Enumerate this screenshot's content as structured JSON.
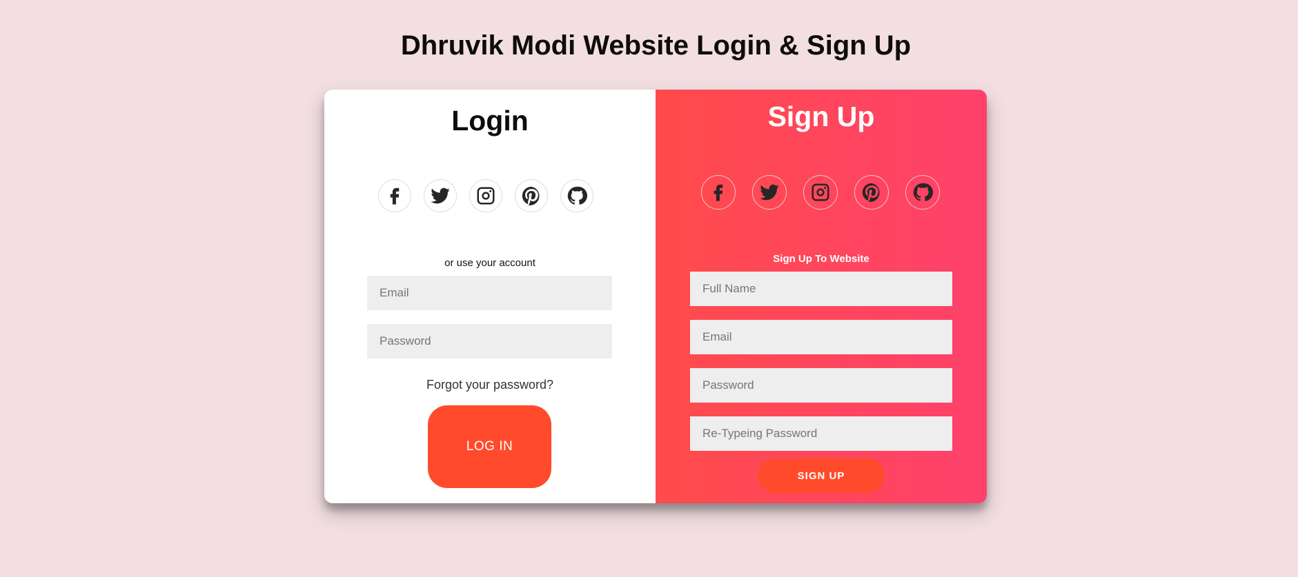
{
  "page": {
    "title": "Dhruvik Modi Website Login & Sign Up"
  },
  "login": {
    "title": "Login",
    "social_icons": [
      "facebook-icon",
      "twitter-icon",
      "instagram-icon",
      "pinterest-icon",
      "github-icon"
    ],
    "hint": "or use your account",
    "email_placeholder": "Email",
    "password_placeholder": "Password",
    "forgot_text": "Forgot your password?",
    "button_label": "LOG IN"
  },
  "signup": {
    "title": "Sign Up",
    "social_icons": [
      "facebook-icon",
      "twitter-icon",
      "instagram-icon",
      "pinterest-icon",
      "github-icon"
    ],
    "hint": "Sign Up To Website",
    "fullname_placeholder": "Full Name",
    "email_placeholder": "Email",
    "password_placeholder": "Password",
    "retype_placeholder": "Re-Typeing Password",
    "button_label": "SIGN UP"
  },
  "colors": {
    "background": "#f3dfe2",
    "accent_button": "#ff4b2b",
    "gradient_start": "#ff4b4b",
    "gradient_end": "#ff416c",
    "field_background": "#eeeeee"
  }
}
